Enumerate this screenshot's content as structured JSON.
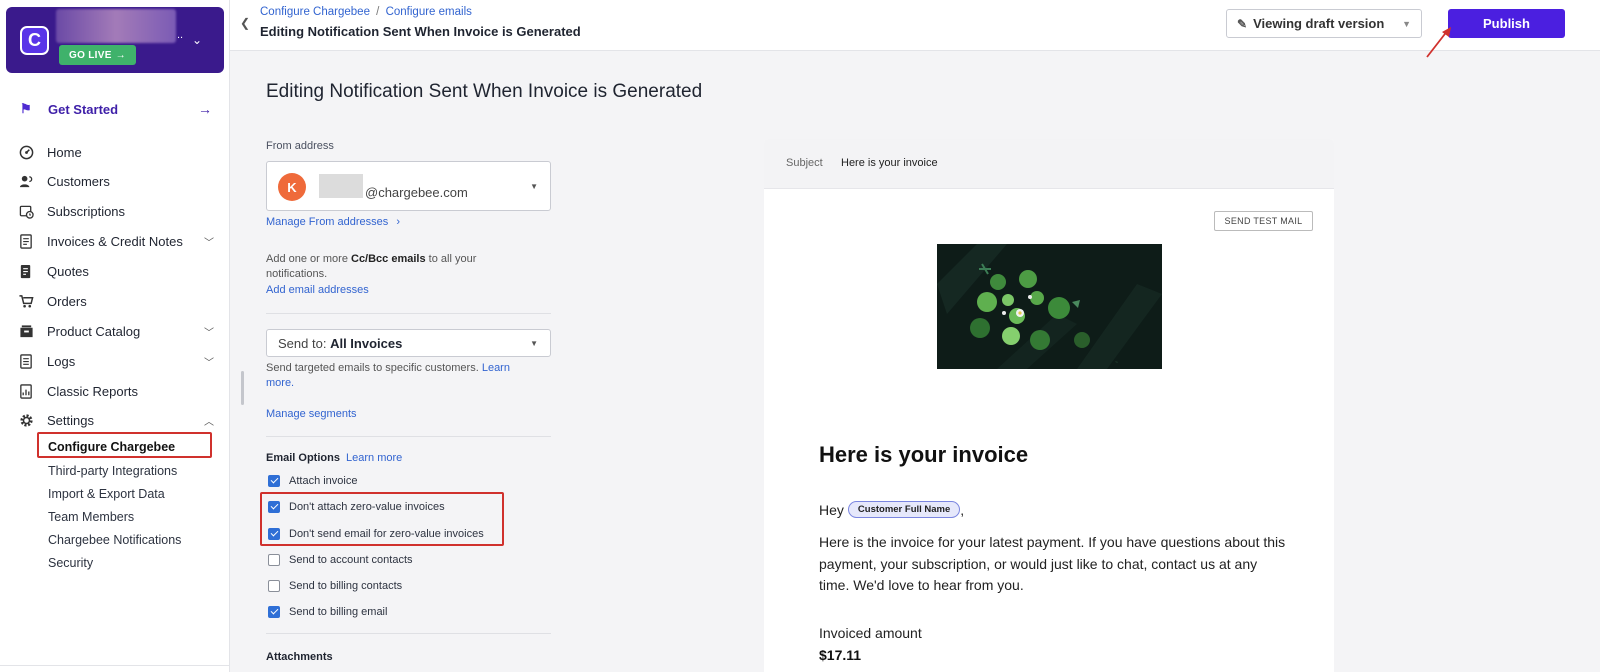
{
  "brand": {
    "go_live": "GO LIVE",
    "dots": ".."
  },
  "sidebar": {
    "get_started": "Get Started",
    "items": [
      {
        "label": "Home",
        "icon": "dashboard-icon"
      },
      {
        "label": "Customers",
        "icon": "users-icon"
      },
      {
        "label": "Subscriptions",
        "icon": "calendar-clock-icon"
      },
      {
        "label": "Invoices & Credit Notes",
        "icon": "invoice-icon",
        "expandable": true
      },
      {
        "label": "Quotes",
        "icon": "quote-icon"
      },
      {
        "label": "Orders",
        "icon": "cart-icon"
      },
      {
        "label": "Product Catalog",
        "icon": "catalog-icon",
        "expandable": true
      },
      {
        "label": "Logs",
        "icon": "log-icon",
        "expandable": true
      },
      {
        "label": "Classic Reports",
        "icon": "report-icon"
      },
      {
        "label": "Settings",
        "icon": "gear-icon",
        "expanded": true
      }
    ],
    "settings_sub": [
      "Configure Chargebee",
      "Third-party Integrations",
      "Import & Export Data",
      "Team Members",
      "Chargebee Notifications",
      "Security"
    ]
  },
  "topbar": {
    "breadcrumb_1": "Configure Chargebee",
    "breadcrumb_sep": "/",
    "breadcrumb_2": "Configure emails",
    "title": "Editing Notification Sent When Invoice is Generated",
    "draft_label": "Viewing draft version",
    "publish_label": "Publish"
  },
  "main": {
    "title": "Editing Notification Sent When Invoice is Generated",
    "from_label": "From address",
    "from_avatar": "K",
    "from_email": "@chargebee.com",
    "manage_from": "Manage From addresses",
    "cc_text_1": "Add one or more",
    "cc_text_bold": "Cc/Bcc emails",
    "cc_text_2": "to all your notifications.",
    "add_email": "Add email addresses",
    "send_to_prefix": "Send to:",
    "send_to_value": "All Invoices",
    "targeted_text": "Send targeted emails to specific customers.",
    "learn_more": "Learn more.",
    "manage_segments": "Manage segments",
    "email_options_title": "Email Options",
    "email_options_learn": "Learn more",
    "options": [
      {
        "label": "Attach invoice",
        "checked": true
      },
      {
        "label": "Don't attach zero-value invoices",
        "checked": true
      },
      {
        "label": "Don't send email for zero-value invoices",
        "checked": true
      },
      {
        "label": "Send to account contacts",
        "checked": false
      },
      {
        "label": "Send to billing contacts",
        "checked": false
      },
      {
        "label": "Send to billing email",
        "checked": true
      }
    ],
    "attachments_title": "Attachments"
  },
  "preview": {
    "subject_label": "Subject",
    "subject_value": "Here is your invoice",
    "send_test_mail": "SEND TEST MAIL",
    "heading": "Here is your invoice",
    "greeting": "Hey",
    "placeholder_pill": "Customer Full Name",
    "greeting_end": ",",
    "body": "Here is the invoice for your latest payment. If you have questions about this payment, your subscription, or would just like to chat, contact us at any time. We'd love to hear from you.",
    "invoiced_label": "Invoiced amount",
    "invoiced_amount": "$17.11"
  },
  "colors": {
    "brand_purple": "#3a1a8c",
    "publish": "#4b1fe0",
    "link": "#3264d0",
    "highlight_red": "#d0312d",
    "go_live_green": "#3fb26b",
    "avatar_orange": "#ef6a3a"
  }
}
